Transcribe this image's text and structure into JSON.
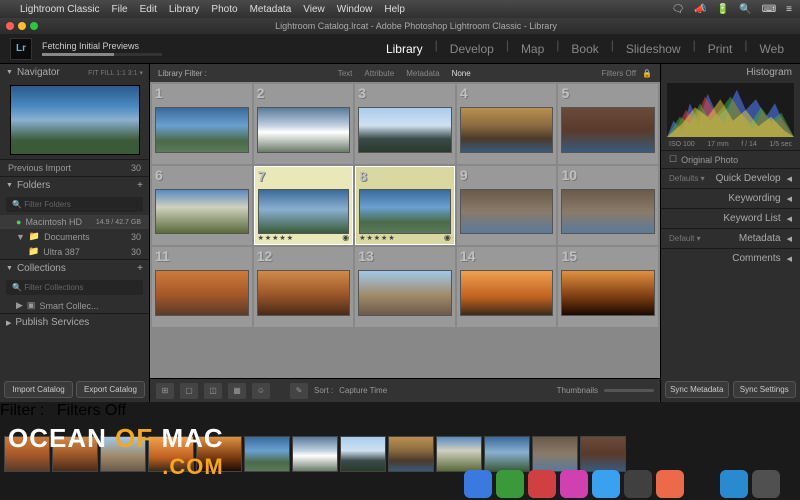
{
  "menubar": {
    "app": "Lightroom Classic",
    "items": [
      "File",
      "Edit",
      "Library",
      "Photo",
      "Metadata",
      "View",
      "Window",
      "Help"
    ],
    "right": [
      "🗨",
      "☁",
      "🔋",
      "🔍",
      "⌨",
      "≡"
    ]
  },
  "titlebar": {
    "title": "Lightroom Catalog.lrcat - Adobe Photoshop Lightroom Classic - Library"
  },
  "header": {
    "progress_label": "Fetching Initial Previews",
    "modules": [
      "Library",
      "Develop",
      "Map",
      "Book",
      "Slideshow",
      "Print",
      "Web"
    ],
    "active_module": "Library"
  },
  "left": {
    "navigator": "Navigator",
    "nav_modes": "FIT   FILL   1:1   3:1  ▾",
    "prev_import": {
      "label": "Previous Import",
      "count": "30"
    },
    "folders": {
      "label": "Folders",
      "filter_placeholder": "Filter Folders",
      "volume": {
        "name": "Macintosh HD",
        "meta": "14.9 / 42.7 GB"
      },
      "items": [
        {
          "name": "Documents",
          "count": "30"
        },
        {
          "name": "Ultra 387",
          "count": "30"
        }
      ]
    },
    "collections": {
      "label": "Collections",
      "filter_placeholder": "Filter Collections",
      "items": [
        {
          "name": "Smart Collec...",
          "count": ""
        }
      ]
    },
    "publish": "Publish Services",
    "import_btn": "Import Catalog",
    "export_btn": "Export Catalog"
  },
  "filterbar": {
    "label": "Library Filter :",
    "tabs": [
      "Text",
      "Attribute",
      "Metadata",
      "None"
    ],
    "active": "None",
    "filters_off": "Filters Off"
  },
  "grid": {
    "cells": [
      {
        "n": "1",
        "t": "t1"
      },
      {
        "n": "2",
        "t": "t2"
      },
      {
        "n": "3",
        "t": "t3"
      },
      {
        "n": "4",
        "t": "t4"
      },
      {
        "n": "5",
        "t": "t5"
      },
      {
        "n": "6",
        "t": "t6"
      },
      {
        "n": "7",
        "t": "t7",
        "sel": 2,
        "stars": "★★★★★"
      },
      {
        "n": "8",
        "t": "t1",
        "sel": 1,
        "stars": "★★★★★"
      },
      {
        "n": "9",
        "t": "t8"
      },
      {
        "n": "10",
        "t": "t8"
      },
      {
        "n": "11",
        "t": "t9"
      },
      {
        "n": "12",
        "t": "t10"
      },
      {
        "n": "13",
        "t": "t11"
      },
      {
        "n": "14",
        "t": "t12"
      },
      {
        "n": "15",
        "t": "t13"
      }
    ]
  },
  "toolbar": {
    "sort_label": "Sort :",
    "sort_value": "Capture Time",
    "thumb_label": "Thumbnails"
  },
  "right": {
    "histogram": "Histogram",
    "histo_meta": {
      "iso": "ISO 100",
      "focal": "17 mm",
      "aperture": "f / 14",
      "shutter": "1/5 sec"
    },
    "original": "Original Photo",
    "sections": [
      {
        "pre": "Defaults ▾",
        "label": "Quick Develop"
      },
      {
        "label": "Keywording"
      },
      {
        "label": "Keyword List"
      },
      {
        "pre": "Default ▾",
        "label": "Metadata"
      },
      {
        "label": "Comments"
      }
    ],
    "sync_meta": "Sync Metadata",
    "sync_settings": "Sync Settings"
  },
  "filmstrip": {
    "filter_label": "Filter :",
    "filters_off": "Filters Off",
    "thumbs": [
      "t9",
      "t10",
      "t11",
      "t12",
      "t13",
      "t1",
      "t2",
      "t3",
      "t4",
      "t6",
      "t7",
      "t8",
      "t5"
    ]
  },
  "watermark": {
    "a": "OCEAN",
    "b": "OF",
    "c": "MAC",
    "d": ".COM"
  },
  "dock": {
    "icons": [
      {
        "c": "#3a7ae0"
      },
      {
        "c": "#3a9a3a"
      },
      {
        "c": "#d04040"
      },
      {
        "c": "#d040b0"
      },
      {
        "c": "#3aa0f0"
      },
      {
        "c": "#404040"
      },
      {
        "c": "#ec6a4a"
      },
      {
        "c": "#1a1a1a"
      },
      {
        "c": "#2a8ad0"
      },
      {
        "c": "#505050"
      }
    ]
  }
}
